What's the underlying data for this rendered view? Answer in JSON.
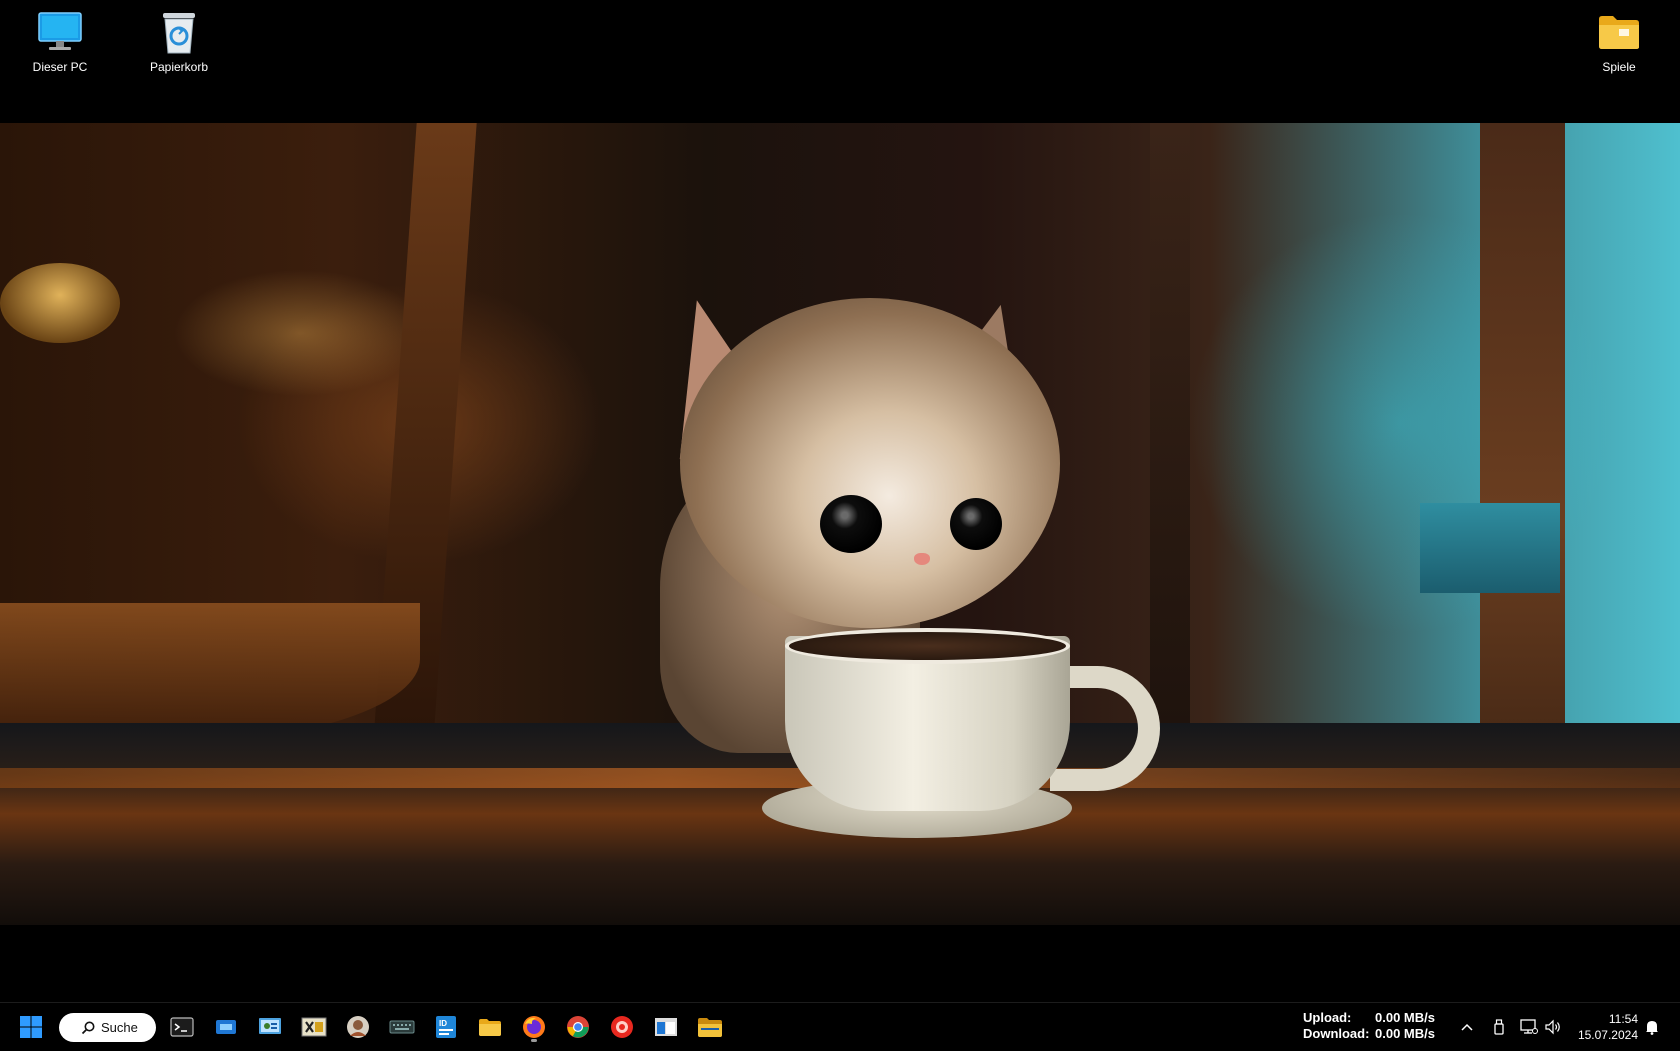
{
  "desktop": {
    "icons": [
      {
        "label": "Dieser PC",
        "icon": "monitor-icon"
      },
      {
        "label": "Papierkorb",
        "icon": "recycle-bin-icon"
      },
      {
        "label": "Spiele",
        "icon": "folder-icon"
      }
    ],
    "wallpaper": "kitten with coffee cup on pirate ship"
  },
  "taskbar": {
    "start_icon": "windows-start-icon",
    "search": {
      "label": "Suche"
    },
    "pinned": [
      {
        "name": "terminal",
        "icon": "terminal-icon"
      },
      {
        "name": "app-blue",
        "icon": "app-window-icon"
      },
      {
        "name": "control-panel",
        "icon": "control-panel-icon"
      },
      {
        "name": "excel-like",
        "icon": "spreadsheet-icon"
      },
      {
        "name": "avatar-app",
        "icon": "avatar-app-icon"
      },
      {
        "name": "keyboard-app",
        "icon": "keyboard-icon"
      },
      {
        "name": "id-app",
        "icon": "id-card-icon"
      },
      {
        "name": "file-explorer",
        "icon": "folder-icon"
      },
      {
        "name": "firefox",
        "icon": "firefox-icon",
        "active": true
      },
      {
        "name": "chrome",
        "icon": "chrome-icon"
      },
      {
        "name": "red-app",
        "icon": "red-circle-app-icon"
      },
      {
        "name": "window-app",
        "icon": "window-icon"
      },
      {
        "name": "folder-app",
        "icon": "folder-icon"
      }
    ],
    "network_speed": {
      "upload_label": "Upload:",
      "upload_value": "0.00 MB/s",
      "download_label": "Download:",
      "download_value": "0.00 MB/s"
    },
    "tray": {
      "chevron": "chevron-up-icon",
      "icons": [
        "usb-drive-icon",
        "network-icon",
        "speaker-icon"
      ],
      "time": "11:54",
      "date": "15.07.2024",
      "notification": "bell-icon"
    }
  },
  "colors": {
    "taskbar_bg": "#000000",
    "accent_blue": "#1a8cff",
    "folder_yellow": "#f5c542"
  }
}
